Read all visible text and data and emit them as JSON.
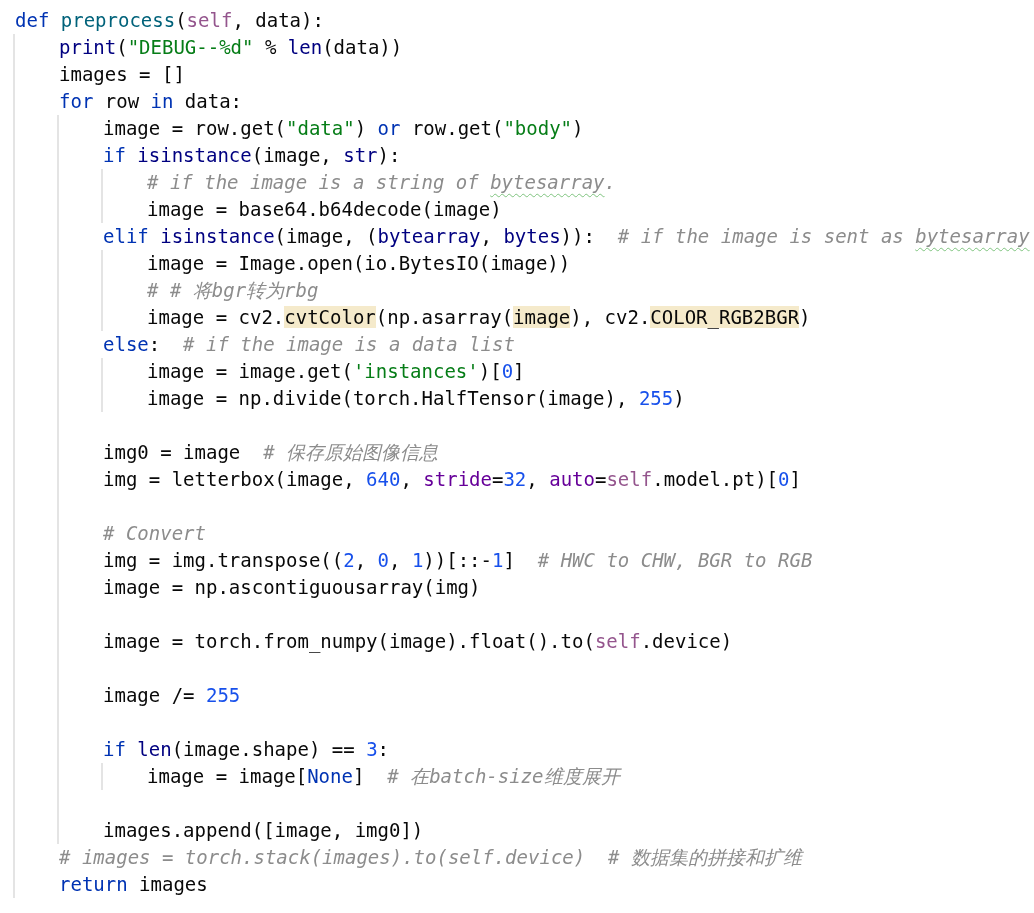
{
  "editor": {
    "lines": [
      {
        "kind": "code",
        "tokens": [
          {
            "kind": "keyword",
            "text": "def "
          },
          {
            "kind": "function",
            "text": "preprocess"
          },
          {
            "kind": "plain",
            "text": "("
          },
          {
            "kind": "self",
            "text": "self"
          },
          {
            "kind": "plain",
            "text": ", data):"
          }
        ],
        "children": [
          {
            "kind": "code",
            "tokens": [
              {
                "kind": "builtin",
                "text": "print"
              },
              {
                "kind": "plain",
                "text": "("
              },
              {
                "kind": "string",
                "text": "\"DEBUG--%d\""
              },
              {
                "kind": "plain",
                "text": " % "
              },
              {
                "kind": "builtin",
                "text": "len"
              },
              {
                "kind": "plain",
                "text": "(data))"
              }
            ]
          },
          {
            "kind": "code",
            "tokens": [
              {
                "kind": "plain",
                "text": "images = []"
              }
            ]
          },
          {
            "kind": "code",
            "tokens": [
              {
                "kind": "keyword",
                "text": "for"
              },
              {
                "kind": "plain",
                "text": " row "
              },
              {
                "kind": "keyword",
                "text": "in"
              },
              {
                "kind": "plain",
                "text": " data:"
              }
            ],
            "children": [
              {
                "kind": "code",
                "tokens": [
                  {
                    "kind": "plain",
                    "text": "image = row.get("
                  },
                  {
                    "kind": "string",
                    "text": "\"data\""
                  },
                  {
                    "kind": "plain",
                    "text": ") "
                  },
                  {
                    "kind": "keyword",
                    "text": "or"
                  },
                  {
                    "kind": "plain",
                    "text": " row.get("
                  },
                  {
                    "kind": "string",
                    "text": "\"body\""
                  },
                  {
                    "kind": "plain",
                    "text": ")"
                  }
                ]
              },
              {
                "kind": "code",
                "tokens": [
                  {
                    "kind": "keyword",
                    "text": "if "
                  },
                  {
                    "kind": "builtin",
                    "text": "isinstance"
                  },
                  {
                    "kind": "plain",
                    "text": "(image, "
                  },
                  {
                    "kind": "builtin",
                    "text": "str"
                  },
                  {
                    "kind": "plain",
                    "text": "):"
                  }
                ],
                "children": [
                  {
                    "kind": "code",
                    "tokens": [
                      {
                        "kind": "comment",
                        "text": "# if the image is a string of "
                      },
                      {
                        "kind": "typo",
                        "text": "bytesarray"
                      },
                      {
                        "kind": "comment",
                        "text": "."
                      }
                    ]
                  },
                  {
                    "kind": "code",
                    "tokens": [
                      {
                        "kind": "plain",
                        "text": "image = base64.b64decode(image)"
                      }
                    ]
                  }
                ]
              },
              {
                "kind": "code",
                "tokens": [
                  {
                    "kind": "keyword",
                    "text": "elif "
                  },
                  {
                    "kind": "builtin",
                    "text": "isinstance"
                  },
                  {
                    "kind": "plain",
                    "text": "(image, ("
                  },
                  {
                    "kind": "builtin",
                    "text": "bytearray"
                  },
                  {
                    "kind": "plain",
                    "text": ", "
                  },
                  {
                    "kind": "builtin",
                    "text": "bytes"
                  },
                  {
                    "kind": "plain",
                    "text": ")):  "
                  },
                  {
                    "kind": "comment",
                    "text": "# if the image is sent as "
                  },
                  {
                    "kind": "typo",
                    "text": "bytesarray"
                  }
                ],
                "children": [
                  {
                    "kind": "code",
                    "tokens": [
                      {
                        "kind": "plain",
                        "text": "image = Image.open(io.BytesIO(image))"
                      }
                    ]
                  },
                  {
                    "kind": "code",
                    "tokens": [
                      {
                        "kind": "comment",
                        "text": "# # 将bgr转为rbg"
                      }
                    ]
                  },
                  {
                    "kind": "code",
                    "tokens": [
                      {
                        "kind": "plain",
                        "text": "image = cv2."
                      },
                      {
                        "kind": "marked",
                        "text": "cvtColor"
                      },
                      {
                        "kind": "plain",
                        "text": "(np.asarray("
                      },
                      {
                        "kind": "marked",
                        "text": "image"
                      },
                      {
                        "kind": "plain",
                        "text": "), cv2."
                      },
                      {
                        "kind": "marked",
                        "text": "COLOR_RGB2BGR"
                      },
                      {
                        "kind": "plain",
                        "text": ")"
                      }
                    ]
                  }
                ]
              },
              {
                "kind": "code",
                "tokens": [
                  {
                    "kind": "keyword",
                    "text": "else"
                  },
                  {
                    "kind": "plain",
                    "text": ":  "
                  },
                  {
                    "kind": "comment",
                    "text": "# if the image is a data list"
                  }
                ],
                "children": [
                  {
                    "kind": "code",
                    "tokens": [
                      {
                        "kind": "plain",
                        "text": "image = image.get("
                      },
                      {
                        "kind": "string",
                        "text": "'instances'"
                      },
                      {
                        "kind": "plain",
                        "text": ")["
                      },
                      {
                        "kind": "number",
                        "text": "0"
                      },
                      {
                        "kind": "plain",
                        "text": "]"
                      }
                    ]
                  },
                  {
                    "kind": "code",
                    "tokens": [
                      {
                        "kind": "plain",
                        "text": "image = np.divide(torch.HalfTensor(image), "
                      },
                      {
                        "kind": "number",
                        "text": "255"
                      },
                      {
                        "kind": "plain",
                        "text": ")"
                      }
                    ]
                  }
                ]
              },
              {
                "kind": "blank"
              },
              {
                "kind": "code",
                "tokens": [
                  {
                    "kind": "plain",
                    "text": "img0 = image  "
                  },
                  {
                    "kind": "comment",
                    "text": "# 保存原始图像信息"
                  }
                ]
              },
              {
                "kind": "code",
                "tokens": [
                  {
                    "kind": "plain",
                    "text": "img = letterbox(image, "
                  },
                  {
                    "kind": "number",
                    "text": "640"
                  },
                  {
                    "kind": "plain",
                    "text": ", "
                  },
                  {
                    "kind": "param",
                    "text": "stride"
                  },
                  {
                    "kind": "plain",
                    "text": "="
                  },
                  {
                    "kind": "number",
                    "text": "32"
                  },
                  {
                    "kind": "plain",
                    "text": ", "
                  },
                  {
                    "kind": "param",
                    "text": "auto"
                  },
                  {
                    "kind": "plain",
                    "text": "="
                  },
                  {
                    "kind": "self",
                    "text": "self"
                  },
                  {
                    "kind": "plain",
                    "text": ".model.pt)["
                  },
                  {
                    "kind": "number",
                    "text": "0"
                  },
                  {
                    "kind": "plain",
                    "text": "]"
                  }
                ]
              },
              {
                "kind": "blank"
              },
              {
                "kind": "code",
                "tokens": [
                  {
                    "kind": "comment",
                    "text": "# Convert"
                  }
                ]
              },
              {
                "kind": "code",
                "tokens": [
                  {
                    "kind": "plain",
                    "text": "img = img.transpose(("
                  },
                  {
                    "kind": "number",
                    "text": "2"
                  },
                  {
                    "kind": "plain",
                    "text": ", "
                  },
                  {
                    "kind": "number",
                    "text": "0"
                  },
                  {
                    "kind": "plain",
                    "text": ", "
                  },
                  {
                    "kind": "number",
                    "text": "1"
                  },
                  {
                    "kind": "plain",
                    "text": "))[::-"
                  },
                  {
                    "kind": "number",
                    "text": "1"
                  },
                  {
                    "kind": "plain",
                    "text": "]  "
                  },
                  {
                    "kind": "comment",
                    "text": "# HWC to CHW, BGR to RGB"
                  }
                ]
              },
              {
                "kind": "code",
                "tokens": [
                  {
                    "kind": "plain",
                    "text": "image = np.ascontiguousarray(img)"
                  }
                ]
              },
              {
                "kind": "blank"
              },
              {
                "kind": "code",
                "tokens": [
                  {
                    "kind": "plain",
                    "text": "image = torch.from_numpy(image).float().to("
                  },
                  {
                    "kind": "self",
                    "text": "self"
                  },
                  {
                    "kind": "plain",
                    "text": ".device)"
                  }
                ]
              },
              {
                "kind": "blank"
              },
              {
                "kind": "code",
                "tokens": [
                  {
                    "kind": "plain",
                    "text": "image /= "
                  },
                  {
                    "kind": "number",
                    "text": "255"
                  }
                ]
              },
              {
                "kind": "blank"
              },
              {
                "kind": "code",
                "tokens": [
                  {
                    "kind": "keyword",
                    "text": "if "
                  },
                  {
                    "kind": "builtin",
                    "text": "len"
                  },
                  {
                    "kind": "plain",
                    "text": "(image.shape) == "
                  },
                  {
                    "kind": "number",
                    "text": "3"
                  },
                  {
                    "kind": "plain",
                    "text": ":"
                  }
                ],
                "children": [
                  {
                    "kind": "code",
                    "tokens": [
                      {
                        "kind": "plain",
                        "text": "image = image["
                      },
                      {
                        "kind": "keyword",
                        "text": "None"
                      },
                      {
                        "kind": "plain",
                        "text": "]  "
                      },
                      {
                        "kind": "comment",
                        "text": "# 在batch-size维度展开"
                      }
                    ]
                  }
                ]
              },
              {
                "kind": "blank"
              },
              {
                "kind": "code",
                "tokens": [
                  {
                    "kind": "plain",
                    "text": "images.append([image, img0])"
                  }
                ]
              }
            ]
          },
          {
            "kind": "code",
            "tokens": [
              {
                "kind": "comment",
                "text": "# images = torch.stack(images).to(self.device)  # 数据集的拼接和扩维"
              }
            ]
          },
          {
            "kind": "code",
            "tokens": [
              {
                "kind": "keyword",
                "text": "return"
              },
              {
                "kind": "plain",
                "text": " images"
              }
            ]
          }
        ]
      }
    ]
  }
}
